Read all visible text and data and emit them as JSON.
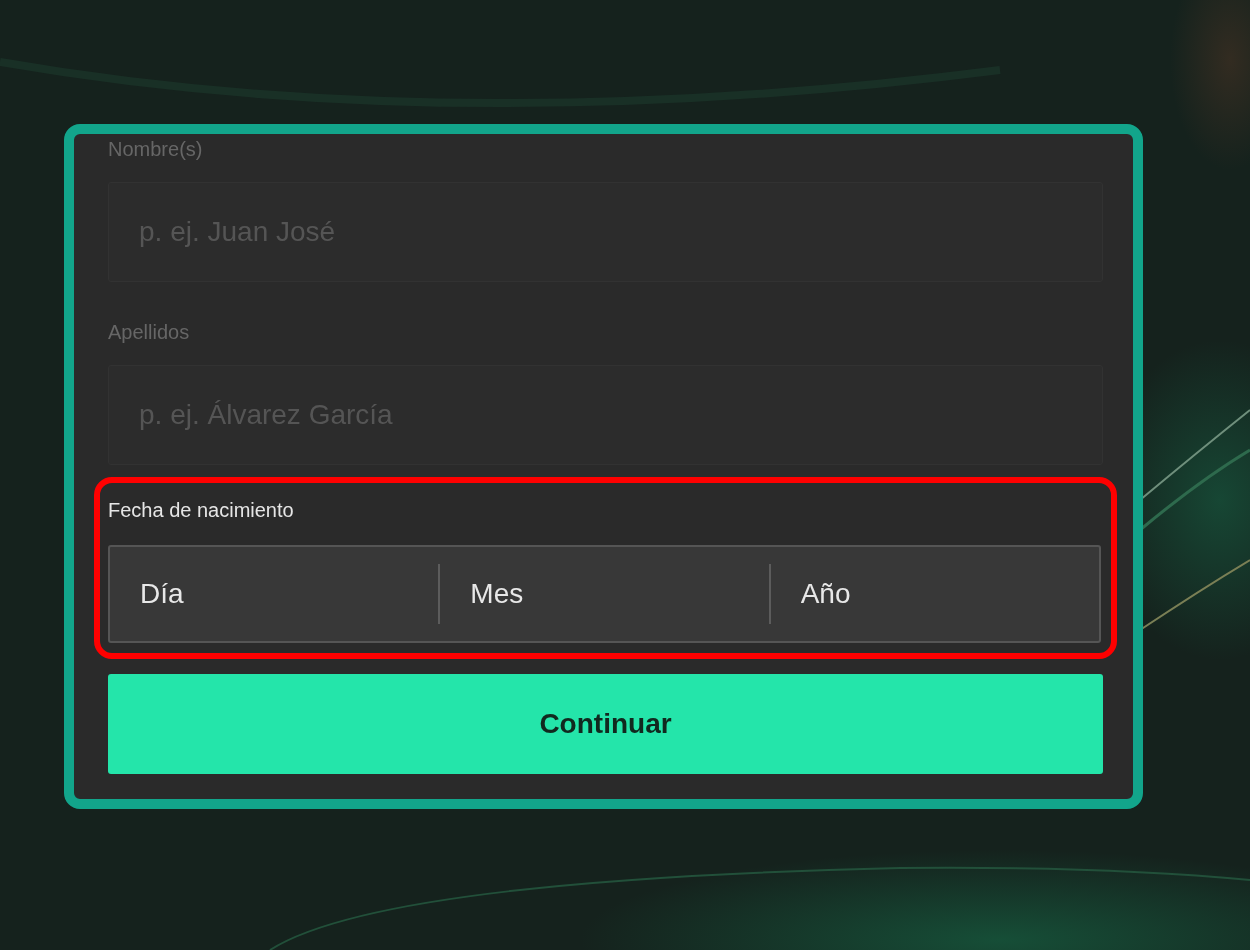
{
  "form": {
    "fields": [
      {
        "kind": "text",
        "label": "Nombre(s)",
        "placeholder": "p. ej. Juan José",
        "dimmed": true
      },
      {
        "kind": "text",
        "label": "Apellidos",
        "placeholder": "p. ej. Álvarez García",
        "dimmed": true
      },
      {
        "kind": "date",
        "label": "Fecha de nacimiento",
        "parts": [
          {
            "placeholder": "Día"
          },
          {
            "placeholder": "Mes"
          },
          {
            "placeholder": "Año"
          }
        ],
        "dimmed": false,
        "highlighted": true
      }
    ],
    "submit_button": "Continuar"
  }
}
